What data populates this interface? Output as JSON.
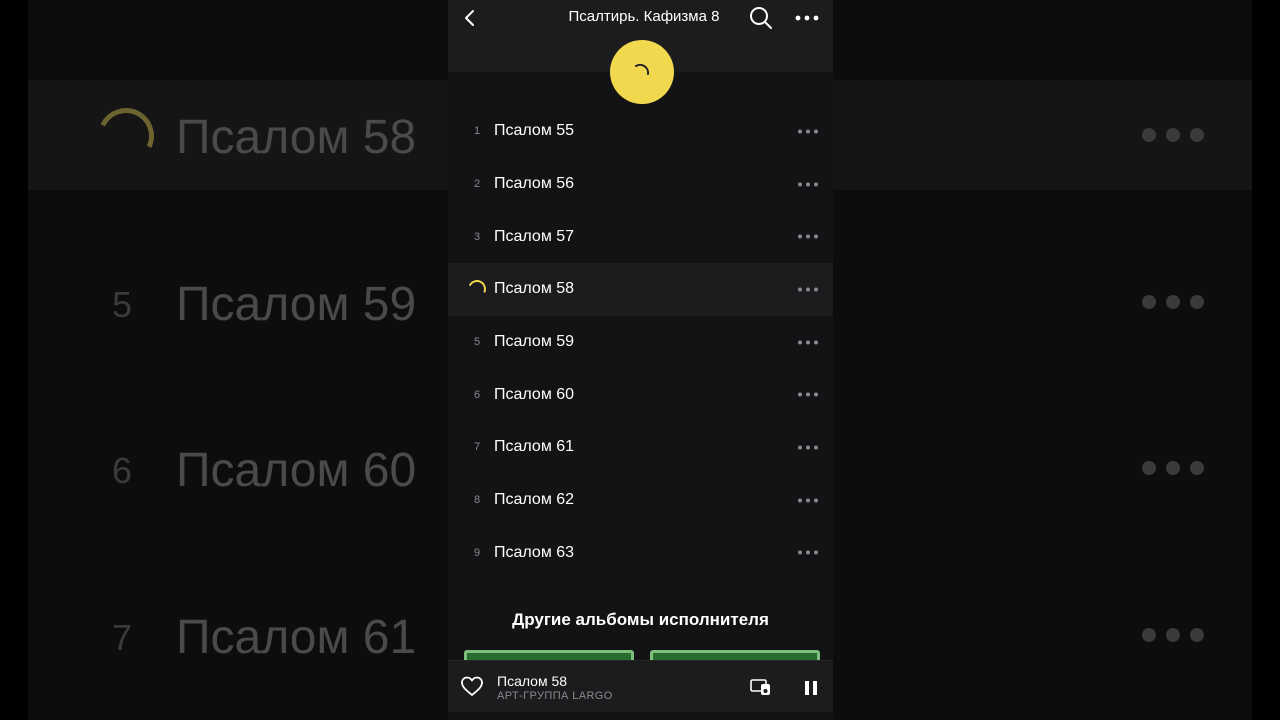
{
  "background": {
    "rows": [
      {
        "num": "",
        "title": "Псалом 58",
        "active": true
      },
      {
        "num": "5",
        "title": "Псалом 59",
        "active": false
      },
      {
        "num": "6",
        "title": "Псалом 60",
        "active": false
      },
      {
        "num": "7",
        "title": "Псалом 61",
        "active": false
      }
    ]
  },
  "header": {
    "title": "Псалтирь. Кафизма 8"
  },
  "tracks": [
    {
      "num": "1",
      "title": "Псалом 55"
    },
    {
      "num": "2",
      "title": "Псалом 56"
    },
    {
      "num": "3",
      "title": "Псалом 57"
    },
    {
      "num": "",
      "title": "Псалом 58",
      "loading": true
    },
    {
      "num": "5",
      "title": "Псалом 59"
    },
    {
      "num": "6",
      "title": "Псалом 60"
    },
    {
      "num": "7",
      "title": "Псалом 61"
    },
    {
      "num": "8",
      "title": "Псалом 62"
    },
    {
      "num": "9",
      "title": "Псалом 63"
    }
  ],
  "other_albums": {
    "title": "Другие альбомы исполнителя"
  },
  "player": {
    "track_title": "Псалом 58",
    "artist": "АРТ-ГРУППА LARGO"
  },
  "colors": {
    "accent": "#f2d84f",
    "background": "#131315"
  }
}
